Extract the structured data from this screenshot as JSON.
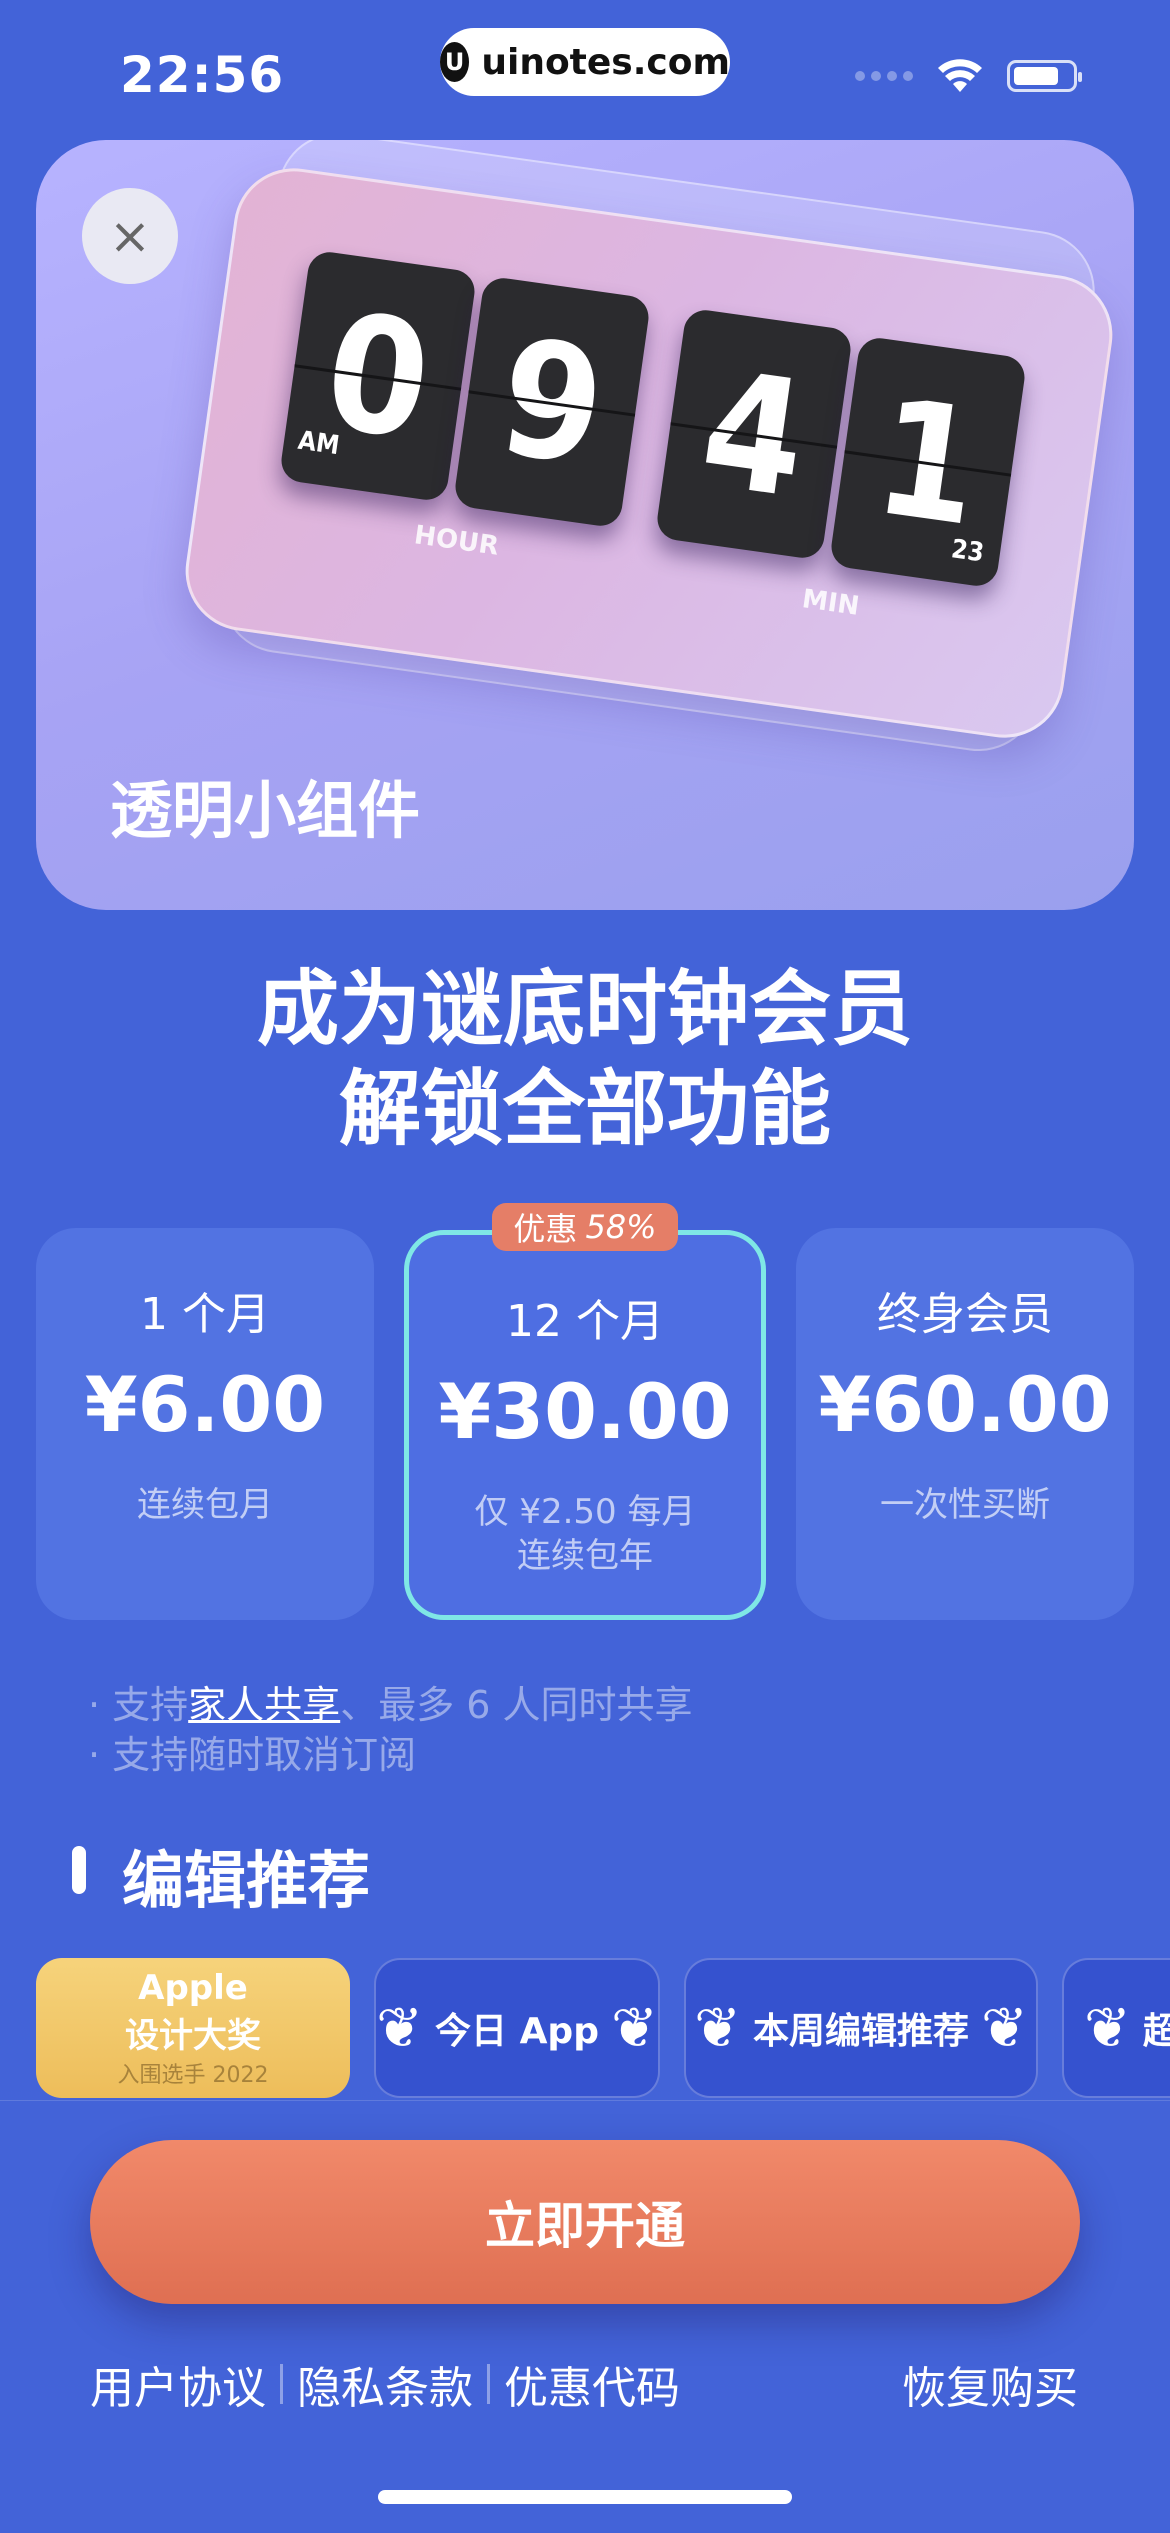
{
  "status_bar": {
    "time": "22:56",
    "watermark": "uinotes.com",
    "watermark_logo": "U"
  },
  "hero": {
    "close_icon": "×",
    "clock": {
      "digits": [
        "0",
        "9",
        "4",
        "1"
      ],
      "am_label": "AM",
      "hour_label": "HOUR",
      "min_label": "MIN",
      "seconds": "23"
    },
    "title": "透明小组件"
  },
  "headline": {
    "line1": "成为谜底时钟会员",
    "line2": "解锁全部功能"
  },
  "plans": [
    {
      "name": "1 个月",
      "price": "¥6.00",
      "sub1": "连续包月",
      "sub2": ""
    },
    {
      "name": "12 个月",
      "price": "¥30.00",
      "sub1": "仅 ¥2.50 每月",
      "sub2": "连续包年",
      "badge": "优惠",
      "badge_pct": "58%"
    },
    {
      "name": "终身会员",
      "price": "¥60.00",
      "sub1": "一次性买断",
      "sub2": ""
    }
  ],
  "notes": {
    "prefix": "· 支持",
    "family_link": "家人共享",
    "suffix": "、最多 6 人同时共享",
    "line2": "· 支持随时取消订阅"
  },
  "section": {
    "title": "编辑推荐"
  },
  "awards": {
    "apple_line1": "Apple",
    "apple_line2": "设计大奖",
    "apple_line3": "入围选手 2022",
    "today": "今日 App",
    "weekly": "本周编辑推荐",
    "partial": "超"
  },
  "cta": {
    "label": "立即开通"
  },
  "footer": {
    "user_agreement": "用户协议",
    "privacy": "隐私条款",
    "promo": "优惠代码",
    "restore": "恢复购买"
  },
  "colors": {
    "background": "#4363d8",
    "cta": "#e57e67",
    "selected_border": "#7fe7e6"
  }
}
